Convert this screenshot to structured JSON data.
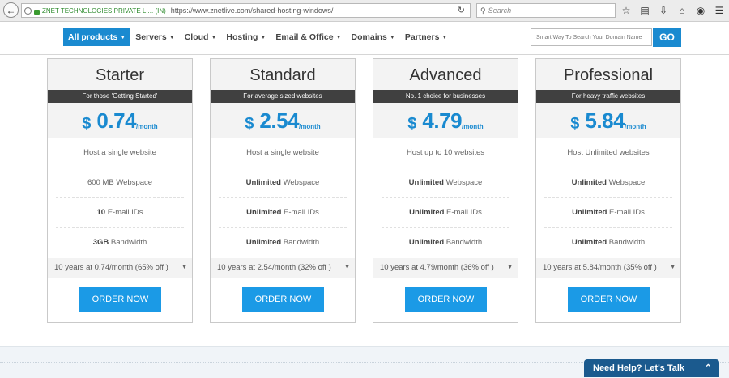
{
  "browser": {
    "site_identity": "ZNET TECHNOLOGIES PRIVATE LI... (IN)",
    "url": "https://www.znetlive.com/shared-hosting-windows/",
    "search_placeholder": "Search"
  },
  "nav": {
    "items": [
      {
        "label": "All products",
        "active": true
      },
      {
        "label": "Servers"
      },
      {
        "label": "Cloud"
      },
      {
        "label": "Hosting"
      },
      {
        "label": "Email & Office"
      },
      {
        "label": "Domains"
      },
      {
        "label": "Partners"
      }
    ],
    "domain_search_placeholder": "Smart Way To Search Your Domain Name",
    "go_label": "GO"
  },
  "plans": [
    {
      "name": "Starter",
      "tagline": "For those 'Getting Started'",
      "currency": "$",
      "price": "0.74",
      "per": "/month",
      "features": [
        {
          "bold": "",
          "text": "Host a single website"
        },
        {
          "bold": "",
          "text": "600 MB Webspace"
        },
        {
          "bold": "10",
          "text": " E-mail IDs"
        },
        {
          "bold": "3GB",
          "text": " Bandwidth"
        }
      ],
      "term": "10 years at 0.74/month (65% off )",
      "order_label": "ORDER NOW"
    },
    {
      "name": "Standard",
      "tagline": "For average sized websites",
      "currency": "$",
      "price": "2.54",
      "per": "/month",
      "features": [
        {
          "bold": "",
          "text": "Host a single website"
        },
        {
          "bold": "Unlimited",
          "text": " Webspace"
        },
        {
          "bold": "Unlimited",
          "text": " E-mail IDs"
        },
        {
          "bold": "Unlimited",
          "text": " Bandwidth"
        }
      ],
      "term": "10 years at 2.54/month (32% off )",
      "order_label": "ORDER NOW"
    },
    {
      "name": "Advanced",
      "tagline": "No. 1 choice for businesses",
      "currency": "$",
      "price": "4.79",
      "per": "/month",
      "features": [
        {
          "bold": "",
          "text": "Host up to 10 websites"
        },
        {
          "bold": "Unlimited",
          "text": " Webspace"
        },
        {
          "bold": "Unlimited",
          "text": " E-mail IDs"
        },
        {
          "bold": "Unlimited",
          "text": " Bandwidth"
        }
      ],
      "term": "10 years at 4.79/month (36% off )",
      "order_label": "ORDER NOW"
    },
    {
      "name": "Professional",
      "tagline": "For heavy traffic websites",
      "currency": "$",
      "price": "5.84",
      "per": "/month",
      "features": [
        {
          "bold": "",
          "text": "Host Unlimited websites"
        },
        {
          "bold": "Unlimited",
          "text": " Webspace"
        },
        {
          "bold": "Unlimited",
          "text": " E-mail IDs"
        },
        {
          "bold": "Unlimited",
          "text": " Bandwidth"
        }
      ],
      "term": "10 years at 5.84/month (35% off )",
      "order_label": "ORDER NOW"
    }
  ],
  "help_tab_label": "Need Help? Let's Talk",
  "colors": {
    "accent": "#1a8ad0",
    "tag_bg": "#404040",
    "help_bg": "#1b5a8e"
  }
}
